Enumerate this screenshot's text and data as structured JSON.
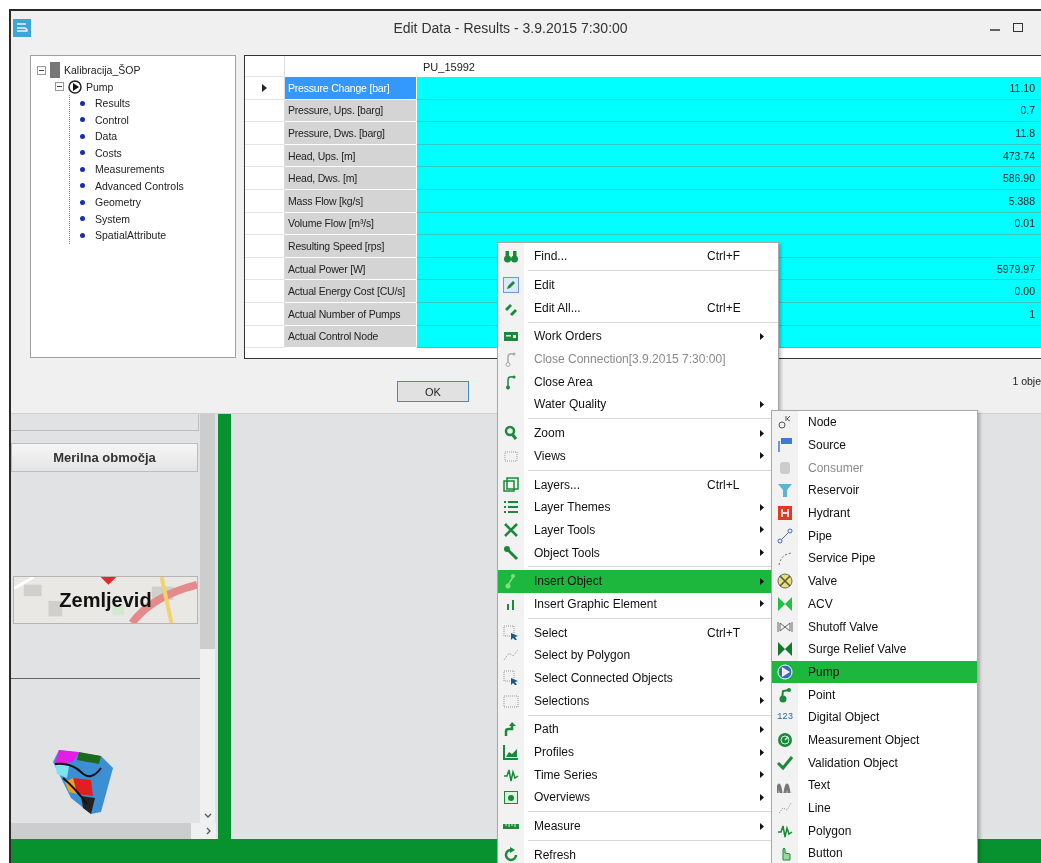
{
  "window": {
    "title": "Edit Data - Results - 3.9.2015 7:30:00"
  },
  "tree": [
    {
      "label": "Kalibracija_ŠOP",
      "expanded": true,
      "children": [
        {
          "label": "Pump",
          "expanded": true,
          "children": [
            {
              "label": "Results"
            },
            {
              "label": "Control"
            },
            {
              "label": "Data"
            },
            {
              "label": "Costs"
            },
            {
              "label": "Measurements"
            },
            {
              "label": "Advanced Controls"
            },
            {
              "label": "Geometry"
            },
            {
              "label": "System"
            },
            {
              "label": "SpatialAttribute"
            }
          ]
        }
      ]
    }
  ],
  "grid": {
    "column": "PU_15992",
    "rows": [
      {
        "name": "Pressure Change [bar]",
        "value": "11.10",
        "selected": true
      },
      {
        "name": "Pressure, Ups. [barg]",
        "value": "0.7",
        "selected": false
      },
      {
        "name": "Pressure, Dws. [barg]",
        "value": "11.8",
        "selected": false
      },
      {
        "name": "Head, Ups. [m]",
        "value": "473.74",
        "selected": false
      },
      {
        "name": "Head, Dws. [m]",
        "value": "586.90",
        "selected": false
      },
      {
        "name": "Mass Flow [kg/s]",
        "value": "5.388",
        "selected": false
      },
      {
        "name": "Volume Flow [m³/s]",
        "value": "0.01",
        "selected": false
      },
      {
        "name": "Resulting Speed [rps]",
        "selected": false
      },
      {
        "name": "Actual Power [W]",
        "value": "5979.97",
        "selected": false
      },
      {
        "name": "Actual Energy Cost [CU/s]",
        "value": "0.00",
        "selected": false
      },
      {
        "name": "Actual Number of Pumps",
        "value": "1",
        "selected": false
      },
      {
        "name": "Actual Control Node",
        "selected": false
      }
    ]
  },
  "ok_button": "OK",
  "status": "1 obje",
  "left_panel": {
    "buttons": [
      "Merilna območja",
      "Zemljevid"
    ]
  },
  "context_menu": {
    "items": [
      {
        "kind": "item",
        "label": "Find...",
        "shortcut": "Ctrl+F",
        "submenu": false,
        "disabled": false,
        "selected": false
      },
      {
        "kind": "separator"
      },
      {
        "kind": "item",
        "label": "Edit",
        "submenu": false,
        "disabled": false,
        "selected": false
      },
      {
        "kind": "item",
        "label": "Edit All...",
        "shortcut": "Ctrl+E",
        "submenu": false,
        "disabled": false,
        "selected": false
      },
      {
        "kind": "separator"
      },
      {
        "kind": "item",
        "label": "Work Orders",
        "submenu": true,
        "disabled": false,
        "selected": false
      },
      {
        "kind": "item",
        "label": "Close Connection[3.9.2015 7:30:00]",
        "submenu": false,
        "disabled": true,
        "selected": false
      },
      {
        "kind": "item",
        "label": "Close Area",
        "submenu": false,
        "disabled": false,
        "selected": false
      },
      {
        "kind": "item",
        "label": "Water Quality",
        "submenu": true,
        "disabled": false,
        "selected": false
      },
      {
        "kind": "separator"
      },
      {
        "kind": "item",
        "label": "Zoom",
        "submenu": true,
        "disabled": false,
        "selected": false
      },
      {
        "kind": "item",
        "label": "Views",
        "submenu": true,
        "disabled": false,
        "selected": false
      },
      {
        "kind": "separator"
      },
      {
        "kind": "item",
        "label": "Layers...",
        "shortcut": "Ctrl+L",
        "submenu": false,
        "disabled": false,
        "selected": false
      },
      {
        "kind": "item",
        "label": "Layer Themes",
        "submenu": true,
        "disabled": false,
        "selected": false
      },
      {
        "kind": "item",
        "label": "Layer Tools",
        "submenu": true,
        "disabled": false,
        "selected": false
      },
      {
        "kind": "item",
        "label": "Object Tools",
        "submenu": true,
        "disabled": false,
        "selected": false
      },
      {
        "kind": "separator"
      },
      {
        "kind": "item",
        "label": "Insert Object",
        "submenu": true,
        "disabled": false,
        "selected": true
      },
      {
        "kind": "item",
        "label": "Insert Graphic Element",
        "submenu": true,
        "disabled": false,
        "selected": false
      },
      {
        "kind": "separator"
      },
      {
        "kind": "item",
        "label": "Select",
        "shortcut": "Ctrl+T",
        "submenu": false,
        "disabled": false,
        "selected": false
      },
      {
        "kind": "item",
        "label": "Select by Polygon",
        "submenu": false,
        "disabled": false,
        "selected": false
      },
      {
        "kind": "item",
        "label": "Select Connected Objects",
        "submenu": true,
        "disabled": false,
        "selected": false
      },
      {
        "kind": "item",
        "label": "Selections",
        "submenu": true,
        "disabled": false,
        "selected": false
      },
      {
        "kind": "separator"
      },
      {
        "kind": "item",
        "label": "Path",
        "submenu": true,
        "disabled": false,
        "selected": false
      },
      {
        "kind": "item",
        "label": "Profiles",
        "submenu": true,
        "disabled": false,
        "selected": false
      },
      {
        "kind": "item",
        "label": "Time Series",
        "submenu": true,
        "disabled": false,
        "selected": false
      },
      {
        "kind": "item",
        "label": "Overviews",
        "submenu": true,
        "disabled": false,
        "selected": false
      },
      {
        "kind": "separator"
      },
      {
        "kind": "item",
        "label": "Measure",
        "submenu": true,
        "disabled": false,
        "selected": false
      },
      {
        "kind": "separator"
      },
      {
        "kind": "item",
        "label": "Refresh",
        "submenu": false,
        "disabled": false,
        "selected": false
      }
    ]
  },
  "submenu": {
    "items": [
      {
        "label": "Node",
        "disabled": false,
        "selected": false
      },
      {
        "label": "Source",
        "disabled": false,
        "selected": false
      },
      {
        "label": "Consumer",
        "disabled": true,
        "selected": false
      },
      {
        "label": "Reservoir",
        "disabled": false,
        "selected": false
      },
      {
        "label": "Hydrant",
        "disabled": false,
        "selected": false
      },
      {
        "label": "Pipe",
        "disabled": false,
        "selected": false
      },
      {
        "label": "Service Pipe",
        "disabled": false,
        "selected": false
      },
      {
        "label": "Valve",
        "disabled": false,
        "selected": false
      },
      {
        "label": "ACV",
        "disabled": false,
        "selected": false
      },
      {
        "label": "Shutoff Valve",
        "disabled": false,
        "selected": false
      },
      {
        "label": "Surge Relief Valve",
        "disabled": false,
        "selected": false
      },
      {
        "label": "Pump",
        "disabled": false,
        "selected": true
      },
      {
        "label": "Point",
        "disabled": false,
        "selected": false
      },
      {
        "label": "Digital Object",
        "icon_text": "123",
        "disabled": false,
        "selected": false
      },
      {
        "label": "Measurement Object",
        "disabled": false,
        "selected": false
      },
      {
        "label": "Validation Object",
        "disabled": false,
        "selected": false
      },
      {
        "label": "Text",
        "disabled": false,
        "selected": false
      },
      {
        "label": "Line",
        "disabled": false,
        "selected": false
      },
      {
        "label": "Polygon",
        "disabled": false,
        "selected": false
      },
      {
        "label": "Button",
        "disabled": false,
        "selected": false
      }
    ]
  }
}
